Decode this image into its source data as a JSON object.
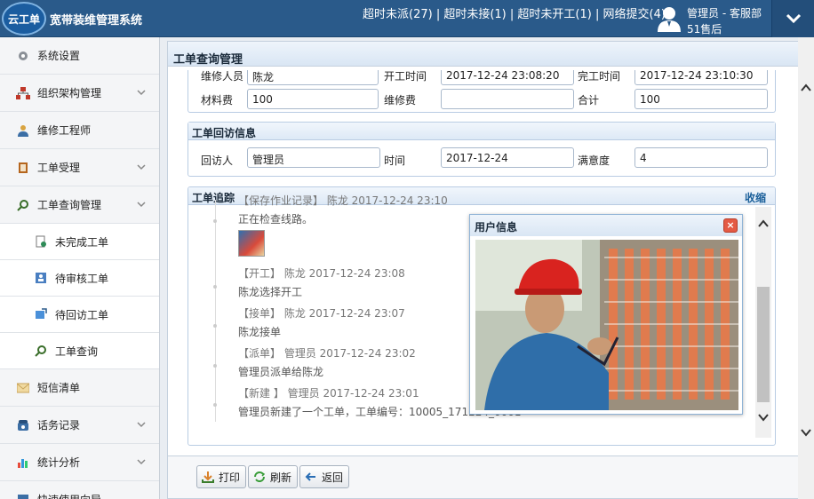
{
  "header": {
    "logo_text": "云工单",
    "title": "宽带装维管理系统",
    "alerts": [
      "超时未派(27)",
      "超时未接(1)",
      "超时未开工(1)",
      "网络提交(4)"
    ],
    "separator": " | ",
    "user_role": "管理员 - 客服部",
    "user_org": "51售后"
  },
  "sidebar": {
    "items": [
      {
        "label": "系统设置",
        "icon": "gear-icon"
      },
      {
        "label": "组织架构管理",
        "icon": "org-chart-icon"
      },
      {
        "label": "维修工程师",
        "icon": "engineer-icon"
      },
      {
        "label": "工单受理",
        "icon": "ticket-icon"
      },
      {
        "label": "工单查询管理",
        "icon": "search-icon"
      },
      {
        "label": "未完成工单",
        "icon": "unfinished-icon"
      },
      {
        "label": "待审核工单",
        "icon": "review-icon"
      },
      {
        "label": "待回访工单",
        "icon": "callback-icon"
      },
      {
        "label": "工单查询",
        "icon": "search-icon"
      },
      {
        "label": "短信清单",
        "icon": "sms-icon"
      },
      {
        "label": "话务记录",
        "icon": "phone-icon"
      },
      {
        "label": "统计分析",
        "icon": "bar-chart-icon"
      },
      {
        "label": "快速使用向导",
        "icon": "guide-icon"
      }
    ]
  },
  "panel": {
    "title": "工单查询管理"
  },
  "cost": {
    "material_label": "材料费",
    "material_value": "100",
    "repair_label": "维修费",
    "repair_value": "",
    "total_label": "合计",
    "total_value": "100",
    "partial_labels": [
      "维修人员",
      "开工时间",
      "完工时间"
    ],
    "partial_values": [
      "陈龙",
      "2017-12-24 23:08:20",
      "2017-12-24 23:10:30"
    ]
  },
  "visit": {
    "title": "工单回访信息",
    "visitor_label": "回访人",
    "visitor_value": "管理员",
    "time_label": "时间",
    "time_value": "2017-12-24",
    "satisfaction_label": "满意度",
    "satisfaction_value": "4"
  },
  "tracking": {
    "title": "工单追踪",
    "collapse_label": "收缩",
    "events": [
      {
        "title": "【保存作业记录】 陈龙 2017-12-24 23:10",
        "desc": "正在检查线路。"
      },
      {
        "title": "【开工】 陈龙 2017-12-24 23:08",
        "desc": "陈龙选择开工"
      },
      {
        "title": "【接单】 陈龙 2017-12-24 23:07",
        "desc": "陈龙接单"
      },
      {
        "title": "【派单】 管理员 2017-12-24 23:02",
        "desc": "管理员派单给陈龙"
      },
      {
        "title": "【新建 】 管理员 2017-12-24 23:01",
        "desc": "管理员新建了一个工单，工单编号：10005_171224_0001"
      }
    ]
  },
  "popup": {
    "title": "用户信息",
    "close": "×"
  },
  "toolbar": {
    "print": "打印",
    "refresh": "刷新",
    "back": "返回"
  },
  "colors": {
    "header_bg": "#2a5a8a",
    "accent": "#1a5f9a",
    "close_red": "#e45a44"
  }
}
